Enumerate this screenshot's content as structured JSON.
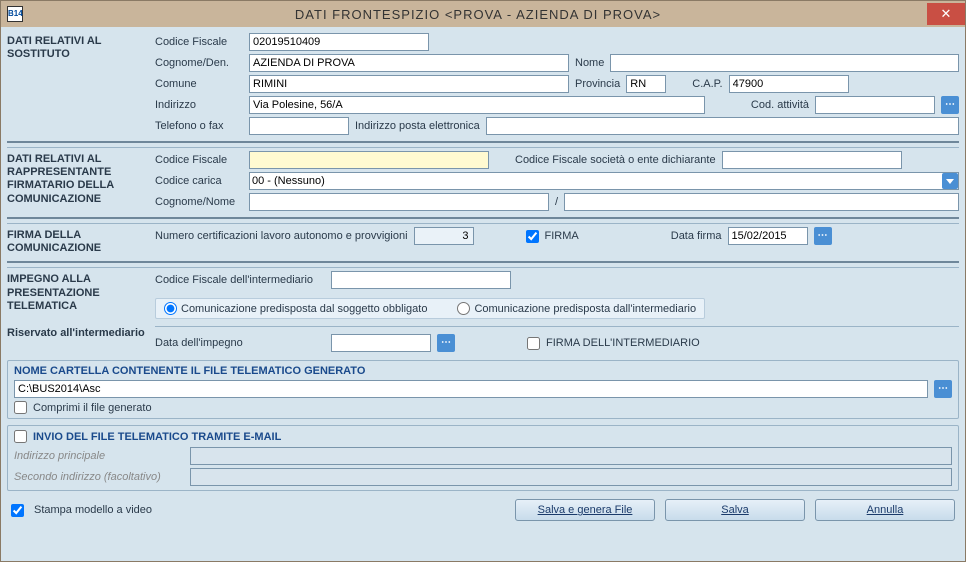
{
  "window": {
    "app_icon": "B14",
    "title": "DATI FRONTESPIZIO <PROVA - AZIENDA DI PROVA>",
    "close": "✕"
  },
  "sec1": {
    "heading": "DATI RELATIVI AL SOSTITUTO",
    "codice_fiscale_label": "Codice Fiscale",
    "codice_fiscale": "02019510409",
    "cognome_den_label": "Cognome/Den.",
    "cognome_den": "AZIENDA DI PROVA",
    "nome_label": "Nome",
    "nome": "",
    "comune_label": "Comune",
    "comune": "RIMINI",
    "provincia_label": "Provincia",
    "provincia": "RN",
    "cap_label": "C.A.P.",
    "cap": "47900",
    "indirizzo_label": "Indirizzo",
    "indirizzo": "Via Polesine, 56/A",
    "cod_attivita_label": "Cod. attività",
    "cod_attivita": "",
    "telefono_label": "Telefono o fax",
    "telefono": "",
    "email_label": "Indirizzo posta elettronica",
    "email": ""
  },
  "sec2": {
    "heading": "DATI RELATIVI AL RAPPRESENTANTE FIRMATARIO DELLA COMUNICAZIONE",
    "codice_fiscale_label": "Codice Fiscale",
    "codice_fiscale": "",
    "cf_societa_label": "Codice Fiscale società o ente dichiarante",
    "cf_societa": "",
    "codice_carica_label": "Codice carica",
    "codice_carica": "00 - (Nessuno)",
    "cognome_nome_label": "Cognome/Nome",
    "cognome": "",
    "nome": "",
    "slash": "/"
  },
  "sec3": {
    "heading": "FIRMA DELLA COMUNICAZIONE",
    "num_cert_label": "Numero certificazioni lavoro autonomo e provvigioni",
    "num_cert": "3",
    "firma_label": "FIRMA",
    "data_firma_label": "Data firma",
    "data_firma": "15/02/2015"
  },
  "sec4": {
    "heading": "IMPEGNO ALLA PRESENTAZIONE TELEMATICA",
    "heading2": "Riservato all'intermediario",
    "cf_int_label": "Codice Fiscale dell'intermediario",
    "cf_int": "",
    "radio1": "Comunicazione predisposta dal soggetto obbligato",
    "radio2": "Comunicazione predisposta dall'intermediario",
    "data_impegno_label": "Data dell'impegno",
    "data_impegno": "",
    "firma_int_label": "FIRMA DELL'INTERMEDIARIO"
  },
  "panel1": {
    "title": "NOME CARTELLA CONTENENTE IL FILE TELEMATICO GENERATO",
    "path": "C:\\BUS2014\\Asc",
    "comprimi_label": "Comprimi il file generato"
  },
  "panel2": {
    "title": "INVIO DEL FILE TELEMATICO TRAMITE E-MAIL",
    "addr1_label": "Indirizzo principale",
    "addr1": "",
    "addr2_label": "Secondo indirizzo (facoltativo)",
    "addr2": ""
  },
  "footer": {
    "stampa_label": "Stampa modello a video",
    "salva_genera": "Salva e genera File",
    "salva": "Salva",
    "annulla": "Annulla"
  }
}
